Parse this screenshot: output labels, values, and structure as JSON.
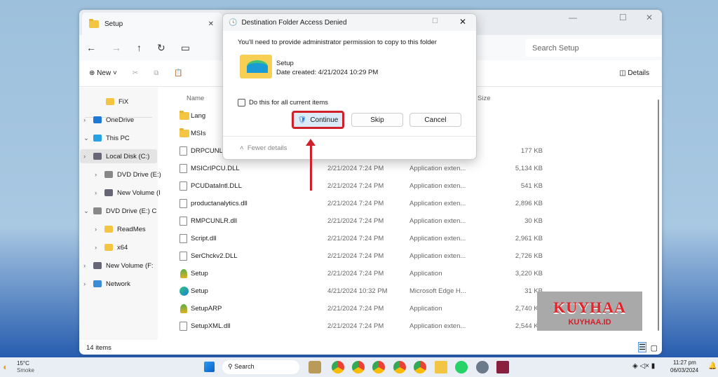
{
  "explorer": {
    "tab_title": "Setup",
    "search_placeholder": "Search Setup",
    "new_label": "New",
    "details_label": "Details",
    "columns": {
      "name": "Name",
      "size": "Size"
    },
    "sidebar": [
      {
        "label": "FiX",
        "icon": "folder-icon"
      },
      {
        "label": "OneDrive",
        "icon": "cloud-icon"
      },
      {
        "label": "This PC",
        "icon": "monitor-icon"
      },
      {
        "label": "Local Disk (C:)",
        "icon": "drive-icon"
      },
      {
        "label": "DVD Drive (E:)",
        "icon": "dvd-icon"
      },
      {
        "label": "New Volume (I",
        "icon": "drive-icon"
      },
      {
        "label": "DVD Drive (E:) C",
        "icon": "dvd-icon"
      },
      {
        "label": "ReadMes",
        "icon": "folder-icon"
      },
      {
        "label": "x64",
        "icon": "folder-icon"
      },
      {
        "label": "New Volume (F:",
        "icon": "drive-icon"
      },
      {
        "label": "Network",
        "icon": "network-icon"
      }
    ],
    "files": [
      {
        "name": "Lang",
        "date": "",
        "type": "",
        "size": "",
        "icon": "folder-icon"
      },
      {
        "name": "MSIs",
        "date": "",
        "type": "",
        "size": "",
        "icon": "folder-icon"
      },
      {
        "name": "DRPCUNL",
        "date": "",
        "type": "",
        "size": "177 KB",
        "icon": "dll-icon"
      },
      {
        "name": "MSICrIPCU.DLL",
        "date": "2/21/2024 7:24 PM",
        "type": "Application exten...",
        "size": "5,134 KB",
        "icon": "dll-icon"
      },
      {
        "name": "PCUDataIntl.DLL",
        "date": "2/21/2024 7:24 PM",
        "type": "Application exten...",
        "size": "541 KB",
        "icon": "dll-icon"
      },
      {
        "name": "productanalytics.dll",
        "date": "2/21/2024 7:24 PM",
        "type": "Application exten...",
        "size": "2,896 KB",
        "icon": "dll-icon"
      },
      {
        "name": "RMPCUNLR.dll",
        "date": "2/21/2024 7:24 PM",
        "type": "Application exten...",
        "size": "30 KB",
        "icon": "dll-icon"
      },
      {
        "name": "Script.dll",
        "date": "2/21/2024 7:24 PM",
        "type": "Application exten...",
        "size": "2,961 KB",
        "icon": "dll-icon"
      },
      {
        "name": "SerChckv2.DLL",
        "date": "2/21/2024 7:24 PM",
        "type": "Application exten...",
        "size": "2,726 KB",
        "icon": "dll-icon"
      },
      {
        "name": "Setup",
        "date": "2/21/2024 7:24 PM",
        "type": "Application",
        "size": "3,220 KB",
        "icon": "app-icon"
      },
      {
        "name": "Setup",
        "date": "4/21/2024 10:32 PM",
        "type": "Microsoft Edge H...",
        "size": "31 KB",
        "icon": "edge-icon"
      },
      {
        "name": "SetupARP",
        "date": "2/21/2024 7:24 PM",
        "type": "Application",
        "size": "2,740 KB",
        "icon": "app-icon"
      },
      {
        "name": "SetupXML.dll",
        "date": "2/21/2024 7:24 PM",
        "type": "Application exten...",
        "size": "2,544 KB",
        "icon": "dll-icon"
      }
    ],
    "status": "14 items"
  },
  "dialog": {
    "title": "Destination Folder Access Denied",
    "message": "You'll need to provide administrator permission to copy to this folder",
    "item_name": "Setup",
    "item_date": "Date created: 4/21/2024 10:29 PM",
    "checkbox_label": "Do this for all current items",
    "checkbox_checked": false,
    "continue": "Continue",
    "skip": "Skip",
    "cancel": "Cancel",
    "fewer_details": "Fewer details",
    "highlight_color": "#d0202a"
  },
  "watermark": {
    "title": "KUYHAA",
    "subtitle": "KUYHAA.ID"
  },
  "taskbar": {
    "weather_temp": "15°C",
    "weather_desc": "Smoke",
    "search": "Search",
    "time": "11:27 pm",
    "date": "06/03/2024"
  }
}
